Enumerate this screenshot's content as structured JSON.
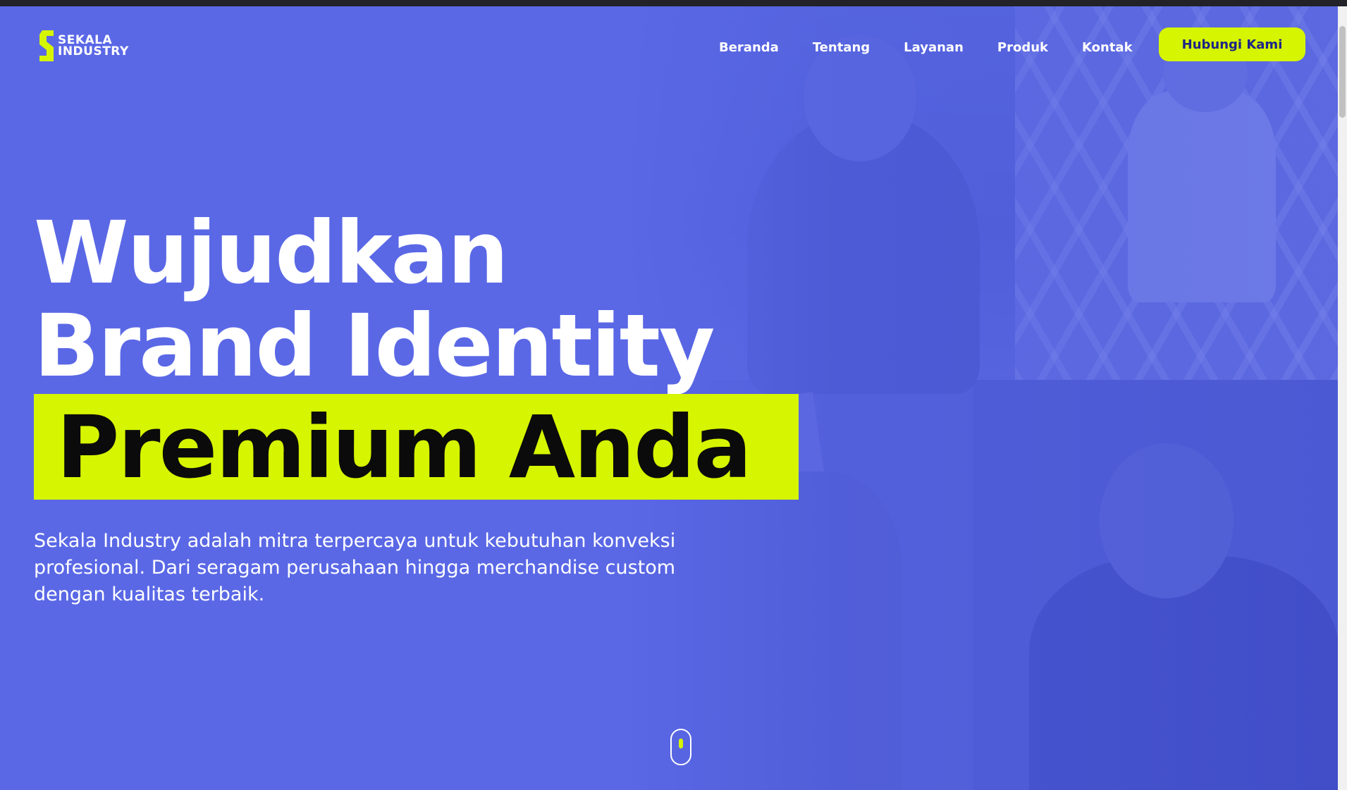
{
  "brand": {
    "line1": "SEKALA",
    "line2": "INDUSTRY",
    "accent_color": "#d6f500",
    "primary_color": "#5a68e6"
  },
  "nav": {
    "items": [
      {
        "label": "Beranda"
      },
      {
        "label": "Tentang"
      },
      {
        "label": "Layanan"
      },
      {
        "label": "Produk"
      },
      {
        "label": "Kontak"
      }
    ],
    "cta_label": "Hubungi Kami"
  },
  "hero": {
    "title_line1": "Wujudkan",
    "title_line2": "Brand Identity",
    "title_highlight": "Premium Anda",
    "description": "Sekala Industry adalah mitra terpercaya untuk kebutuhan konveksi profesional. Dari seragam perusahaan hingga merchandise custom dengan kualitas terbaik."
  },
  "scroll_indicator": {
    "icon": "mouse-scroll-icon"
  }
}
